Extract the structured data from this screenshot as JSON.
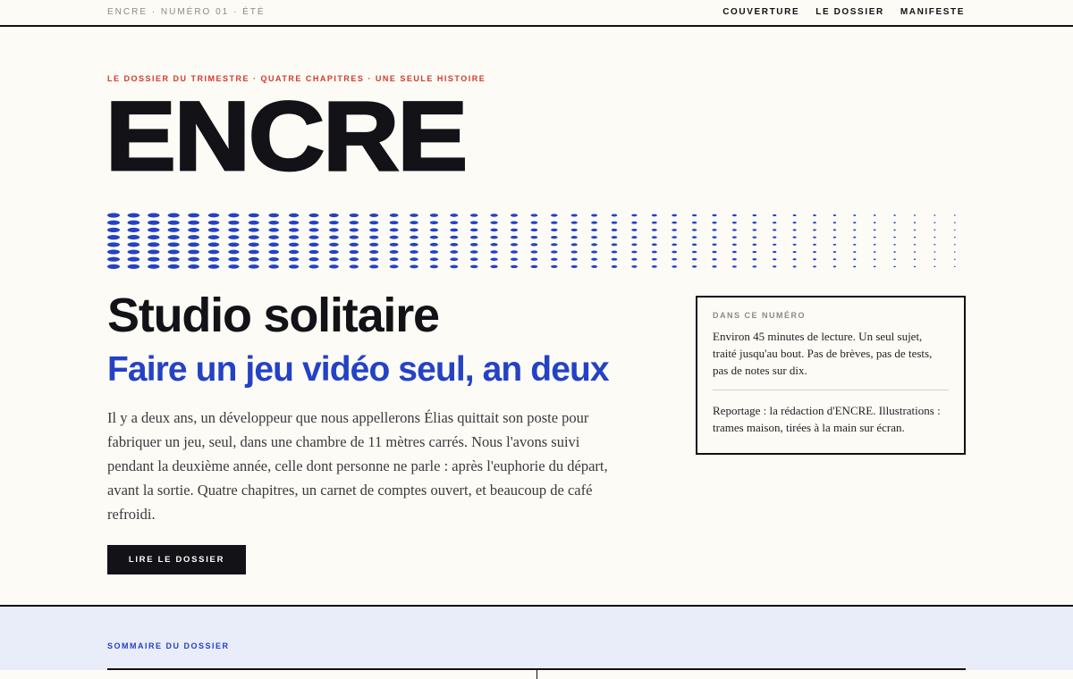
{
  "header": {
    "issue": "ENCRE · NUMÉRO 01 · ÉTÉ",
    "nav": [
      "COUVERTURE",
      "LE DOSSIER",
      "MANIFESTE"
    ]
  },
  "hero": {
    "kicker": "LE DOSSIER DU TRIMESTRE · QUATRE CHAPITRES · UNE SEULE HISTOIRE",
    "masthead": "ENCRE",
    "title": "Studio solitaire",
    "subtitle": "Faire un jeu vidéo seul, an deux",
    "intro": "Il y a deux ans, un développeur que nous appellerons Élias quittait son poste pour fabriquer un jeu, seul, dans une chambre de 11 mètres carrés. Nous l'avons suivi pendant la deuxième année, celle dont personne ne parle : après l'euphorie du départ, avant la sortie. Quatre chapitres, un carnet de comptes ouvert, et beaucoup de café refroidi.",
    "cta": "LIRE LE DOSSIER"
  },
  "infobox": {
    "label": "DANS CE NUMÉRO",
    "text1": "Environ 45 minutes de lecture. Un seul sujet, traité jusqu'au bout. Pas de brèves, pas de tests, pas de notes sur dix.",
    "text2": "Reportage : la rédaction d'ENCRE. Illustrations : trames maison, tirées à la main sur écran."
  },
  "sommaire": {
    "label": "SOMMAIRE DU DOSSIER"
  },
  "colors": {
    "accent_blue": "#2442c5",
    "accent_red": "#d23a2a",
    "ink": "#121217",
    "paper": "#fcfbf6",
    "lower_bg": "#e9ecf9"
  },
  "icons": []
}
